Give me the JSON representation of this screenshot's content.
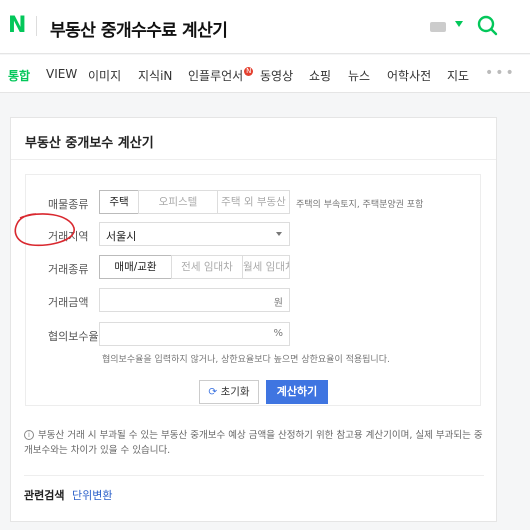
{
  "header": {
    "logo": "N",
    "query": "부동산 중개수수료 계산기"
  },
  "tabs": [
    {
      "label": "통합",
      "active": true
    },
    {
      "label": "VIEW"
    },
    {
      "label": "이미지"
    },
    {
      "label": "지식iN"
    },
    {
      "label": "인플루언서",
      "badge": "N"
    },
    {
      "label": "동영상"
    },
    {
      "label": "쇼핑"
    },
    {
      "label": "뉴스"
    },
    {
      "label": "어학사전"
    },
    {
      "label": "지도"
    }
  ],
  "card": {
    "title": "부동산 중개보수 계산기",
    "property_type": {
      "label": "매물종류",
      "options": [
        "주택",
        "오피스텔",
        "주택 외 부동산"
      ],
      "hint": "주택의 부속토지, 주택분양권 포함"
    },
    "region": {
      "label": "거래지역",
      "value": "서울시"
    },
    "deal_type": {
      "label": "거래종류",
      "options": [
        "매매/교환",
        "전세 임대차",
        "월세 임대차"
      ]
    },
    "amount": {
      "label": "거래금액",
      "unit": "원"
    },
    "fee_rate": {
      "label": "협의보수율",
      "unit": "%",
      "hint": "협의보수율을 입력하지 않거나, 상한요율보다 높으면 상한요율이 적용됩니다."
    },
    "buttons": {
      "reset": "초기화",
      "calculate": "계산하기"
    },
    "note": "부동산 거래 시 부과될 수 있는 부동산 중개보수 예상 금액을 산정하기 위한 참고용 계산기이며, 실제 부과되는 중개보수와는 차이가 있을 수 있습니다.",
    "related": {
      "label": "관련검색",
      "link": "단위변환"
    }
  },
  "colors": {
    "brand": "#03c75a",
    "primary_button": "#3f75e1",
    "annotation": "#d9282f"
  }
}
